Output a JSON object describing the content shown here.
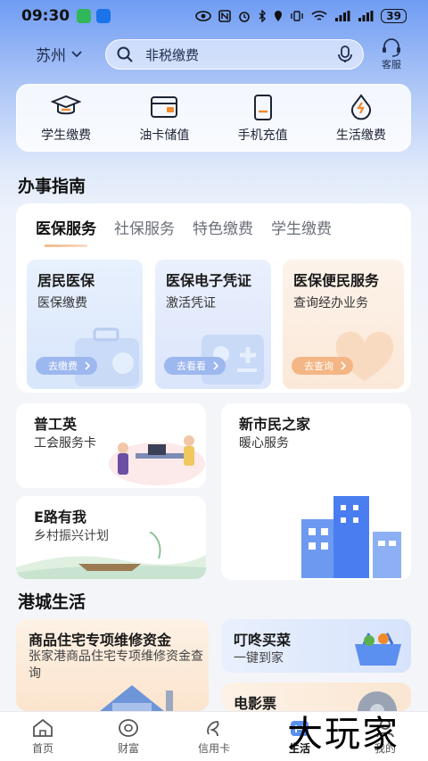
{
  "status_bar": {
    "time": "09:30",
    "battery": "39",
    "wechat_color": "#2fb75a",
    "app_color": "#1a73e8"
  },
  "header": {
    "city": "苏州",
    "search_placeholder": "非税缴费",
    "service_label": "客服"
  },
  "quick_actions": [
    {
      "label": "学生缴费",
      "icon": "graduation-cap-icon"
    },
    {
      "label": "油卡储值",
      "icon": "fuel-card-icon"
    },
    {
      "label": "手机充值",
      "icon": "phone-icon"
    },
    {
      "label": "生活缴费",
      "icon": "utility-drop-icon"
    }
  ],
  "guide": {
    "title": "办事指南",
    "tabs": [
      "医保服务",
      "社保服务",
      "特色缴费",
      "学生缴费"
    ],
    "active_tab": "医保服务",
    "cards": [
      {
        "title": "居民医保",
        "subtitle": "医保缴费",
        "button": "去缴费"
      },
      {
        "title": "医保电子凭证",
        "subtitle": "激活凭证",
        "button": "去看看"
      },
      {
        "title": "医保便民服务",
        "subtitle": "查询经办业务",
        "button": "去查询"
      }
    ]
  },
  "promos": [
    {
      "title": "普工英",
      "subtitle": "工会服务卡"
    },
    {
      "title": "新市民之家",
      "subtitle": "暖心服务"
    },
    {
      "title": "E路有我",
      "subtitle": "乡村振兴计划"
    }
  ],
  "life": {
    "title": "港城生活",
    "cards": [
      {
        "title": "商品住宅专项维修资金",
        "subtitle": "张家港商品住宅专项维修资金查询"
      },
      {
        "title": "叮咚买菜",
        "subtitle": "一键到家"
      },
      {
        "title": "电影票",
        "subtitle": ""
      }
    ]
  },
  "nav": {
    "items": [
      {
        "label": "首页",
        "icon": "home-icon"
      },
      {
        "label": "财富",
        "icon": "wealth-icon"
      },
      {
        "label": "信用卡",
        "icon": "credit-card-icon"
      },
      {
        "label": "生活",
        "icon": "life-icon"
      },
      {
        "label": "我的",
        "icon": "profile-icon"
      }
    ],
    "active": "生活"
  },
  "watermark": "大玩家"
}
